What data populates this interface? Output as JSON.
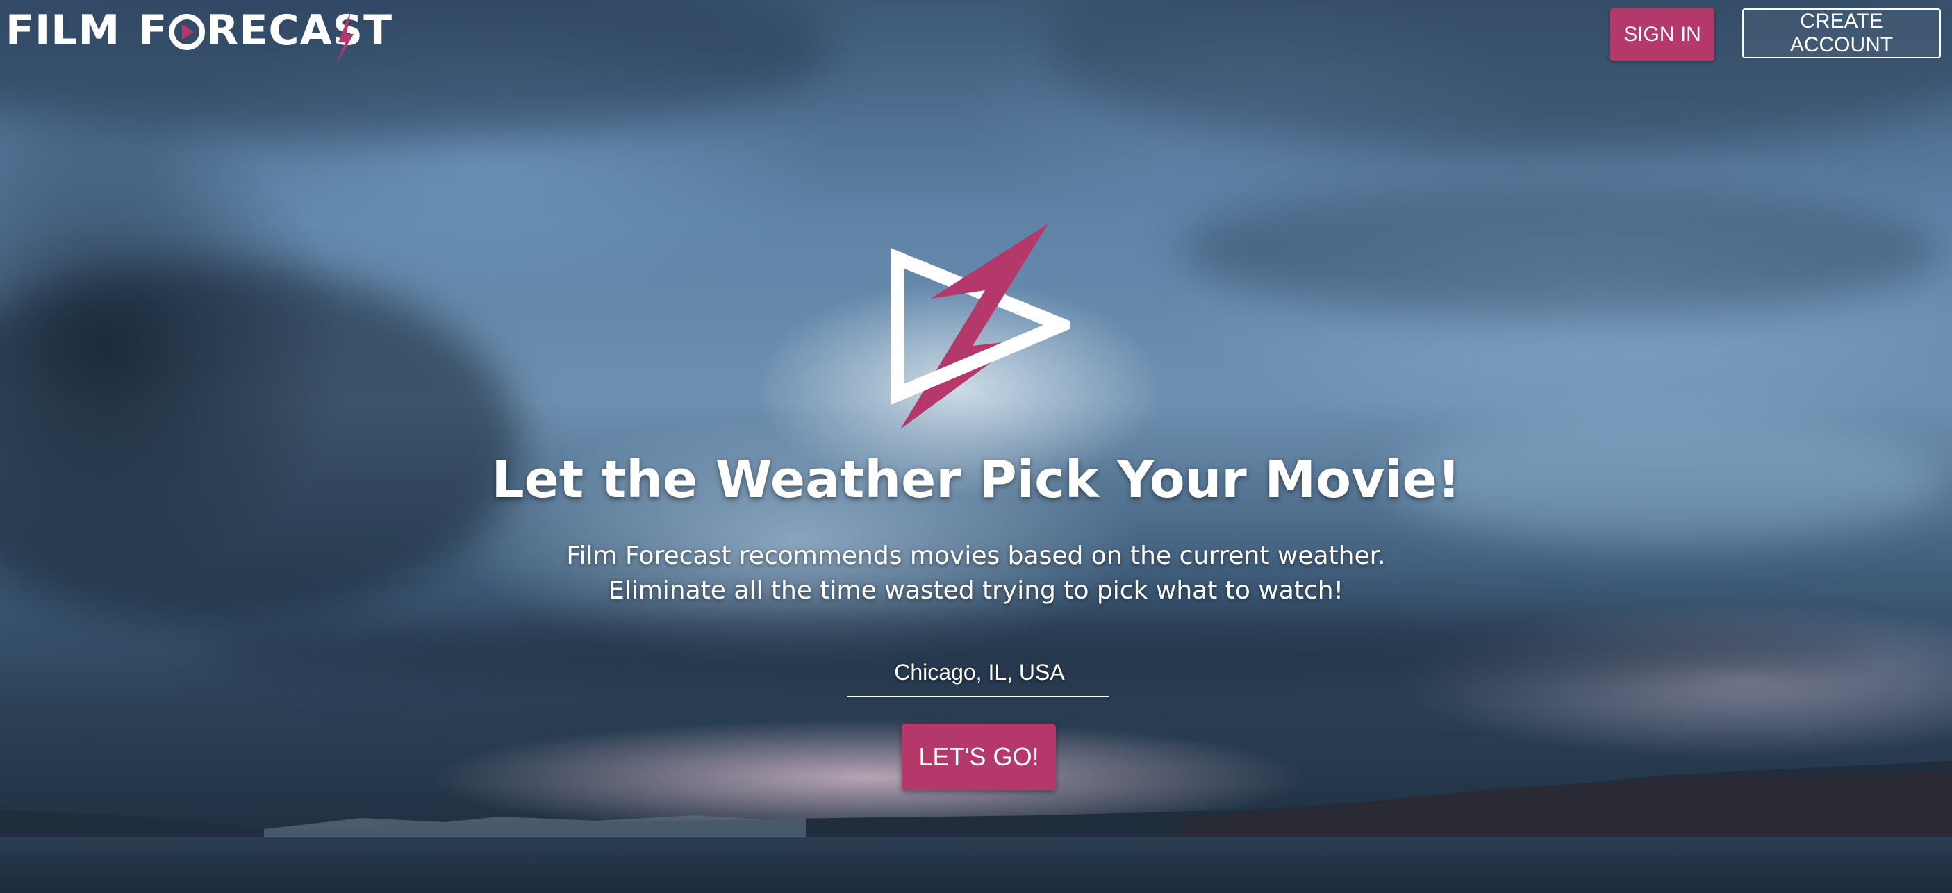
{
  "brand": {
    "name_part1": "FILM",
    "name_part2_a": "F",
    "name_part2_b": "RECAST",
    "logo_icon": "play-bolt-icon",
    "accent_color": "#b5386b"
  },
  "nav": {
    "sign_in_label": "SIGN IN",
    "create_account_label": "CREATE ACCOUNT"
  },
  "hero": {
    "logo_icon": "play-lightning-logo-icon",
    "headline": "Let the Weather Pick Your Movie!",
    "subtitle_line1": "Film Forecast recommends movies based on the current weather.",
    "subtitle_line2": "Eliminate all the time wasted trying to pick what to watch!",
    "location_value": "Chicago, IL, USA",
    "go_label": "LET'S GO!"
  },
  "colors": {
    "primary": "#b5386b",
    "text": "#ffffff"
  }
}
